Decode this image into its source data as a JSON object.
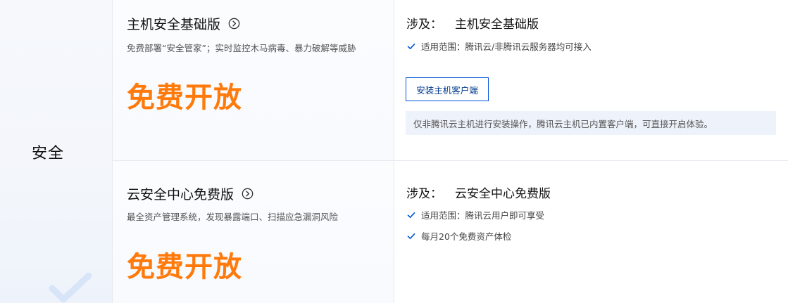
{
  "category": {
    "label": "安全"
  },
  "rows": [
    {
      "product_title": "主机安全基础版",
      "product_desc": "免费部署“安全管家”；实时监控木马病毒、暴力破解等威胁",
      "price_label": "免费开放",
      "scope_prefix": "涉及：",
      "scope_product": "主机安全基础版",
      "checks": [
        "适用范围：腾讯云/非腾讯云服务器均可接入"
      ],
      "install_button": "安装主机客户端",
      "install_note": "仅非腾讯云主机进行安装操作，腾讯云主机已内置客户端，可直接开启体验。"
    },
    {
      "product_title": "云安全中心免费版",
      "product_desc": "最全资产管理系统，发现暴露端口、扫描应急漏洞风险",
      "price_label": "免费开放",
      "scope_prefix": "涉及：",
      "scope_product": "云安全中心免费版",
      "checks": [
        "适用范围：腾讯云用户即可享受",
        "每月20个免费资产体检"
      ]
    }
  ],
  "colors": {
    "price": "#ff7a0a",
    "accent": "#0052d9",
    "check": "#0052d9"
  },
  "icons": {
    "title_arrow": "chevron-right-circle-icon",
    "check": "check-icon",
    "watermark": "check-watermark-icon"
  }
}
